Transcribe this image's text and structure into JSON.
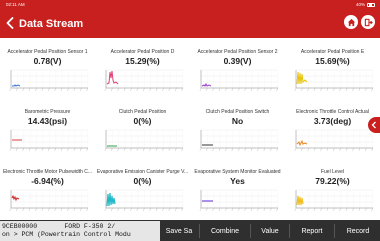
{
  "status_bar": {
    "time": "02:11 AM",
    "battery": "40%"
  },
  "header": {
    "title": "Data Stream"
  },
  "items": [
    {
      "name": "Accelerator Pedal Position Sensor 1",
      "value": "0.78(V)"
    },
    {
      "name": "Accelerator Pedal Position D",
      "value": "15.29(%)"
    },
    {
      "name": "Accelerator Pedal Position Sensor 2",
      "value": "0.39(V)"
    },
    {
      "name": "Accelerator Pedal Position E",
      "value": "15.69(%)"
    },
    {
      "name": "Barometric Pressure",
      "value": "14.43(psi)"
    },
    {
      "name": "Clutch Pedal Position",
      "value": "0(%)"
    },
    {
      "name": "Clutch Pedal Position Switch",
      "value": "No"
    },
    {
      "name": "Electronic Throttle Control Actual",
      "value": "3.73(deg)"
    },
    {
      "name": "Electronic Throttle Motor Pulsewidth C...",
      "value": "-6.94(%)"
    },
    {
      "name": "Evaporative Emission Canister Purge V...",
      "value": "0(%)"
    },
    {
      "name": "Evaporative System Monitor Evaluated",
      "value": "Yes"
    },
    {
      "name": "Fuel Level",
      "value": "79.22(%)"
    }
  ],
  "terminal": {
    "line1": "9CEB00000       FORD F-350 2/",
    "line2": "on > PCM (Powertrain Control Modu"
  },
  "buttons": {
    "save": "Save Sa",
    "combine": "Combine",
    "value": "Value",
    "report": "Report",
    "record": "Record"
  },
  "colors": {
    "header": "#c8201e",
    "bottom_bar": "#2f2f2f"
  },
  "graph_colors": [
    "#3b6fd8",
    "#e0407a",
    "#9b3fd1",
    "#e8c200",
    "#d84040",
    "#2aa24a",
    "#333333",
    "#e8861a",
    "#d02020",
    "#20b8c8",
    "#5a2ad0",
    "#f0c020"
  ]
}
